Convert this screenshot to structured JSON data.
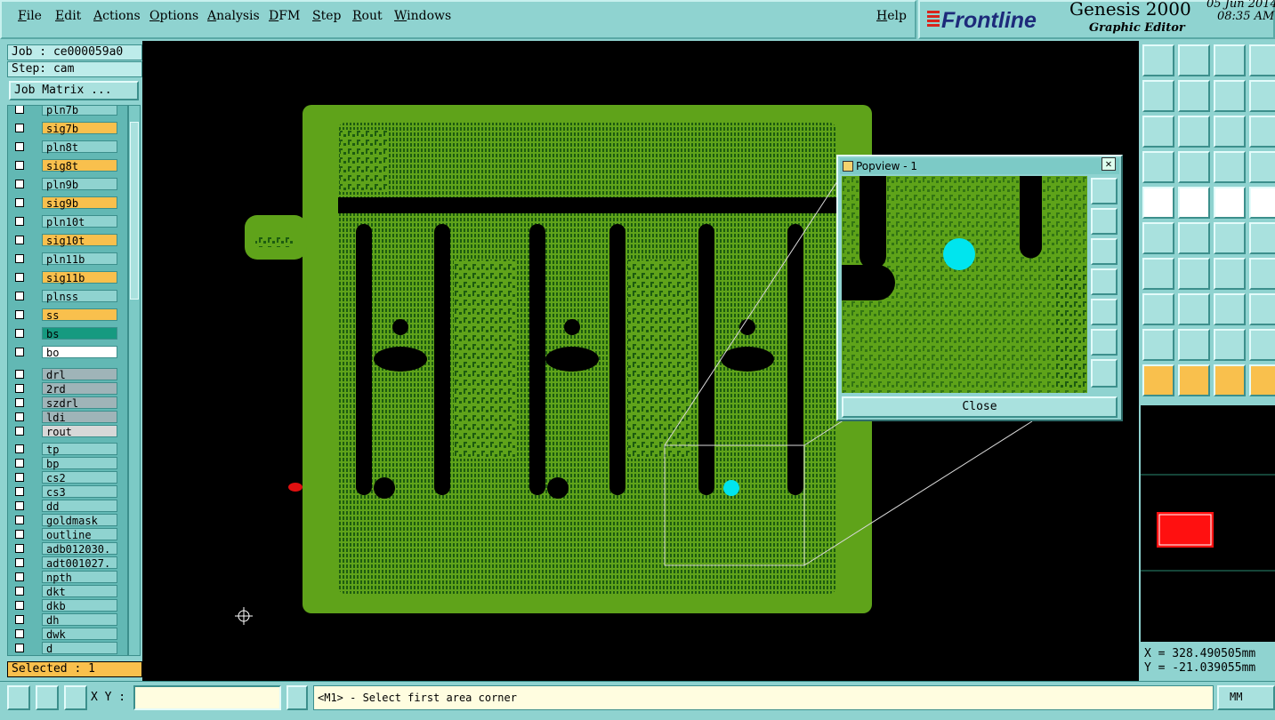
{
  "menu": {
    "items": [
      "File",
      "Edit",
      "Actions",
      "Options",
      "Analysis",
      "DFM",
      "Step",
      "Rout",
      "Windows"
    ],
    "help": "Help"
  },
  "brand": {
    "logo": "Frontline",
    "product": "Genesis 2000",
    "subtitle": "Graphic Editor",
    "date": "05 Jun 2014",
    "time": "08:35 AM"
  },
  "job": {
    "job_label": "Job : ce000059a0",
    "step_label": "Step: cam",
    "matrix_button": "Job Matrix ..."
  },
  "layers": [
    {
      "name": "pln7b",
      "color": "#8fd3d0"
    },
    {
      "name": "sig7b",
      "color": "#f9c04d"
    },
    {
      "name": "pln8t",
      "color": "#8fd3d0"
    },
    {
      "name": "sig8t",
      "color": "#f9c04d"
    },
    {
      "name": "pln9b",
      "color": "#8fd3d0"
    },
    {
      "name": "sig9b",
      "color": "#f9c04d"
    },
    {
      "name": "pln10t",
      "color": "#8fd3d0"
    },
    {
      "name": "sig10t",
      "color": "#f9c04d"
    },
    {
      "name": "pln11b",
      "color": "#8fd3d0"
    },
    {
      "name": "sig11b",
      "color": "#f9c04d"
    },
    {
      "name": "plnss",
      "color": "#8fd3d0"
    },
    {
      "name": "ss",
      "color": "#f9c04d"
    },
    {
      "name": "bs",
      "color": "#169a80"
    },
    {
      "name": "bo",
      "color": "#ffffff"
    },
    {
      "name": "drl",
      "color": "#9fb4b8"
    },
    {
      "name": "2rd",
      "color": "#9fb4b8"
    },
    {
      "name": "szdrl",
      "color": "#9fb4b8"
    },
    {
      "name": "ldi",
      "color": "#9fb4b8"
    },
    {
      "name": "rout",
      "color": "#d8d8d8"
    },
    {
      "name": "tp",
      "color": "#8fd3d0"
    },
    {
      "name": "bp",
      "color": "#8fd3d0"
    },
    {
      "name": "cs2",
      "color": "#8fd3d0"
    },
    {
      "name": "cs3",
      "color": "#8fd3d0"
    },
    {
      "name": "dd",
      "color": "#8fd3d0"
    },
    {
      "name": "goldmask",
      "color": "#8fd3d0"
    },
    {
      "name": "outline",
      "color": "#8fd3d0"
    },
    {
      "name": "adb012030.",
      "color": "#8fd3d0"
    },
    {
      "name": "adt001027.",
      "color": "#8fd3d0"
    },
    {
      "name": "npth",
      "color": "#8fd3d0"
    },
    {
      "name": "dkt",
      "color": "#8fd3d0"
    },
    {
      "name": "dkb",
      "color": "#8fd3d0"
    },
    {
      "name": "dh",
      "color": "#8fd3d0"
    },
    {
      "name": "dwk",
      "color": "#8fd3d0"
    },
    {
      "name": "d",
      "color": "#8fd3d0"
    }
  ],
  "selected_label": "Selected : 1",
  "popview": {
    "title": "Popview - 1",
    "close_button": "Close"
  },
  "coords": {
    "x": "X = 328.490505mm",
    "y": "Y = -21.039055mm"
  },
  "bottom": {
    "xy_label": "X Y :",
    "xy_value": "",
    "prompt": "<M1> - Select first area corner",
    "unit": "MM"
  },
  "colors": {
    "board": "#5fa31a",
    "copper_dark": "#1d5c10",
    "highlight": "#00e5ee",
    "background": "#8fd3d0"
  }
}
